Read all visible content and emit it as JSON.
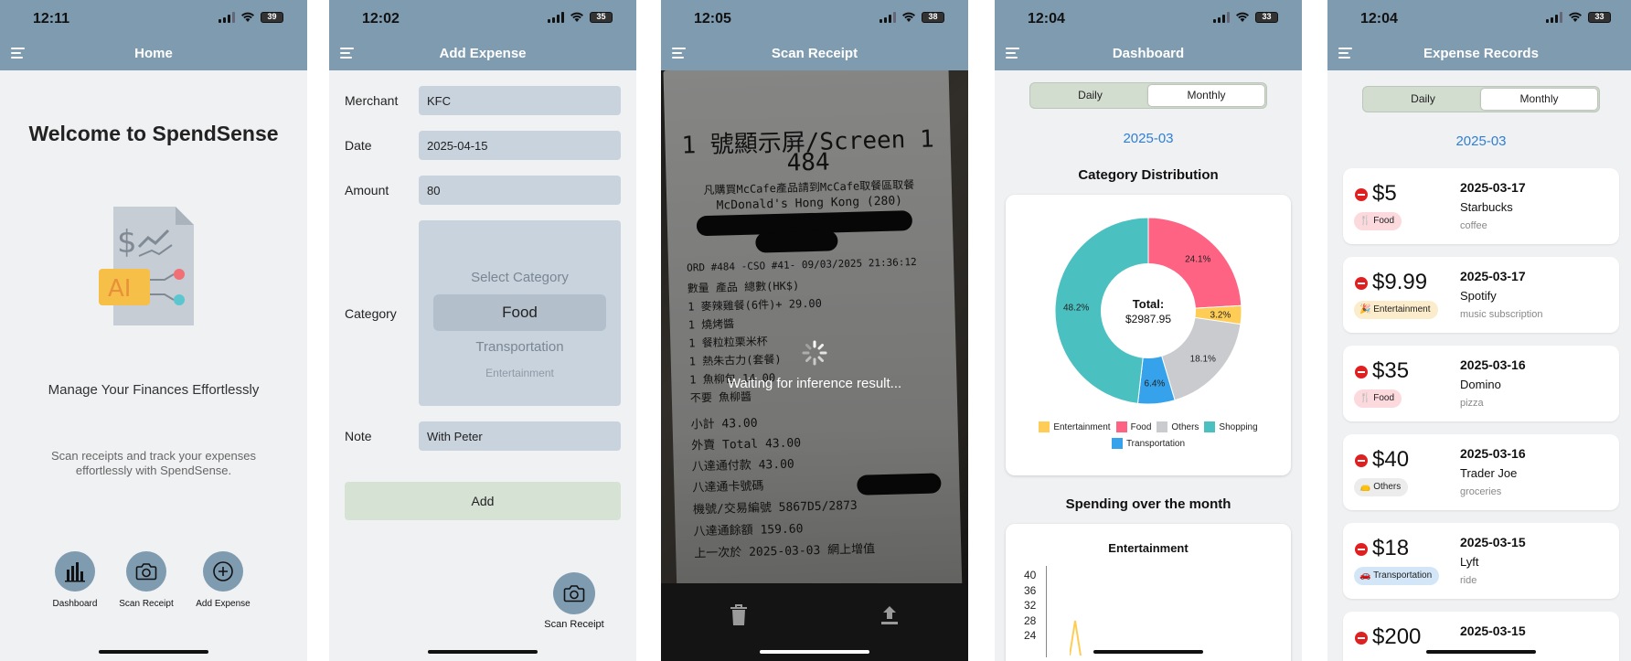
{
  "status": {
    "s1_time": "12:11",
    "s2_time": "12:02",
    "s3_time": "12:05",
    "s4_time": "12:04",
    "s5_time": "12:04",
    "battery1": "39",
    "battery2": "35",
    "battery3": "38",
    "battery4": "33",
    "battery5": "33"
  },
  "home": {
    "nav_title": "Home",
    "welcome": "Welcome to SpendSense",
    "ai_label": "AI",
    "tagline": "Manage Your Finances Effortlessly",
    "subtagline": "Scan receipts and track your expenses effortlessly with SpendSense.",
    "actions": [
      {
        "label": "Dashboard",
        "icon": "bar-chart-icon"
      },
      {
        "label": "Scan Receipt",
        "icon": "camera-icon"
      },
      {
        "label": "Add Expense",
        "icon": "plus-circle-icon"
      }
    ]
  },
  "add_expense": {
    "nav_title": "Add Expense",
    "merchant_label": "Merchant",
    "merchant_value": "KFC",
    "date_label": "Date",
    "date_value": "2025-04-15",
    "amount_label": "Amount",
    "amount_value": "80",
    "category_label": "Category",
    "category_options": [
      "Select Category",
      "Food",
      "Transportation",
      "Entertainment"
    ],
    "category_selected": "Food",
    "note_label": "Note",
    "note_value": "With Peter",
    "add_button": "Add",
    "scan_button": "Scan Receipt"
  },
  "scan": {
    "nav_title": "Scan Receipt",
    "waiting_text": "Waiting for inference result...",
    "receipt_lines": [
      "1 號顯示屏/Screen 1",
      "484",
      "凡購買McCafe產品請到McCafe取餐區取餐",
      "McDonald's Hong Kong (280)",
      "ORD #484 -CSO #41- 09/03/2025 21:36:12",
      "數量 產品                總數(HK$)",
      "1 麥辣雞餐(6件)+            29.00",
      "1 燒烤醬",
      "1 餐粒粒栗米杯",
      "1 熱朱古力(套餐)",
      "1 魚柳包                  14.00",
      "不要 魚柳醬",
      "小計                     43.00",
      "外賣 Total               43.00",
      "八達通付款                43.00",
      "八達通卡號碼",
      "機號/交易編號       5867D5/2873",
      "八達通餘額               159.60",
      "上一次於 2025-03-03 網上增值"
    ]
  },
  "dashboard": {
    "nav_title": "Dashboard",
    "seg_daily": "Daily",
    "seg_monthly": "Monthly",
    "month": "2025-03",
    "category_title": "Category Distribution",
    "total_label": "Total:",
    "total_value": "$2987.95",
    "spending_title": "Spending over the month",
    "line_chart_title": "Entertainment",
    "y_ticks": [
      "40",
      "36",
      "32",
      "28",
      "24"
    ]
  },
  "chart_data": {
    "type": "pie",
    "title": "Category Distribution",
    "categories": [
      "Food",
      "Entertainment",
      "Others",
      "Transportation",
      "Shopping"
    ],
    "values": [
      24.1,
      3.2,
      18.1,
      6.4,
      48.2
    ],
    "labels": [
      "24.1%",
      "3.2%",
      "18.1%",
      "6.4%",
      "48.2%"
    ],
    "colors": [
      "#ff6384",
      "#ffcd56",
      "#c9cbcf",
      "#36a2eb",
      "#4bc0c0"
    ],
    "legend": [
      "Entertainment",
      "Food",
      "Others",
      "Shopping",
      "Transportation"
    ],
    "legend_colors": [
      "#ffcd56",
      "#ff6384",
      "#c9cbcf",
      "#4bc0c0",
      "#36a2eb"
    ],
    "legend_position": "bottom",
    "center_text": "Total: $2987.95"
  },
  "records": {
    "nav_title": "Expense Records",
    "seg_daily": "Daily",
    "seg_monthly": "Monthly",
    "month": "2025-03",
    "items": [
      {
        "amount": "$5",
        "category": "Food",
        "icon": "fork-knife-icon",
        "badge_color": "#fbd9dd",
        "date": "2025-03-17",
        "merchant": "Starbucks",
        "note": "coffee"
      },
      {
        "amount": "$9.99",
        "category": "Entertainment",
        "icon": "party-icon",
        "badge_color": "#fbeccb",
        "date": "2025-03-17",
        "merchant": "Spotify",
        "note": "music subscription"
      },
      {
        "amount": "$35",
        "category": "Food",
        "icon": "fork-knife-icon",
        "badge_color": "#fbd9dd",
        "date": "2025-03-16",
        "merchant": "Domino",
        "note": "pizza"
      },
      {
        "amount": "$40",
        "category": "Others",
        "icon": "pouch-icon",
        "badge_color": "#ececec",
        "date": "2025-03-16",
        "merchant": "Trader Joe",
        "note": "groceries"
      },
      {
        "amount": "$18",
        "category": "Transportation",
        "icon": "car-icon",
        "badge_color": "#d3e6f7",
        "date": "2025-03-15",
        "merchant": "Lyft",
        "note": "ride"
      },
      {
        "amount": "$200",
        "category": "",
        "icon": "",
        "badge_color": "#ffffff",
        "date": "2025-03-15",
        "merchant": "",
        "note": ""
      }
    ]
  }
}
